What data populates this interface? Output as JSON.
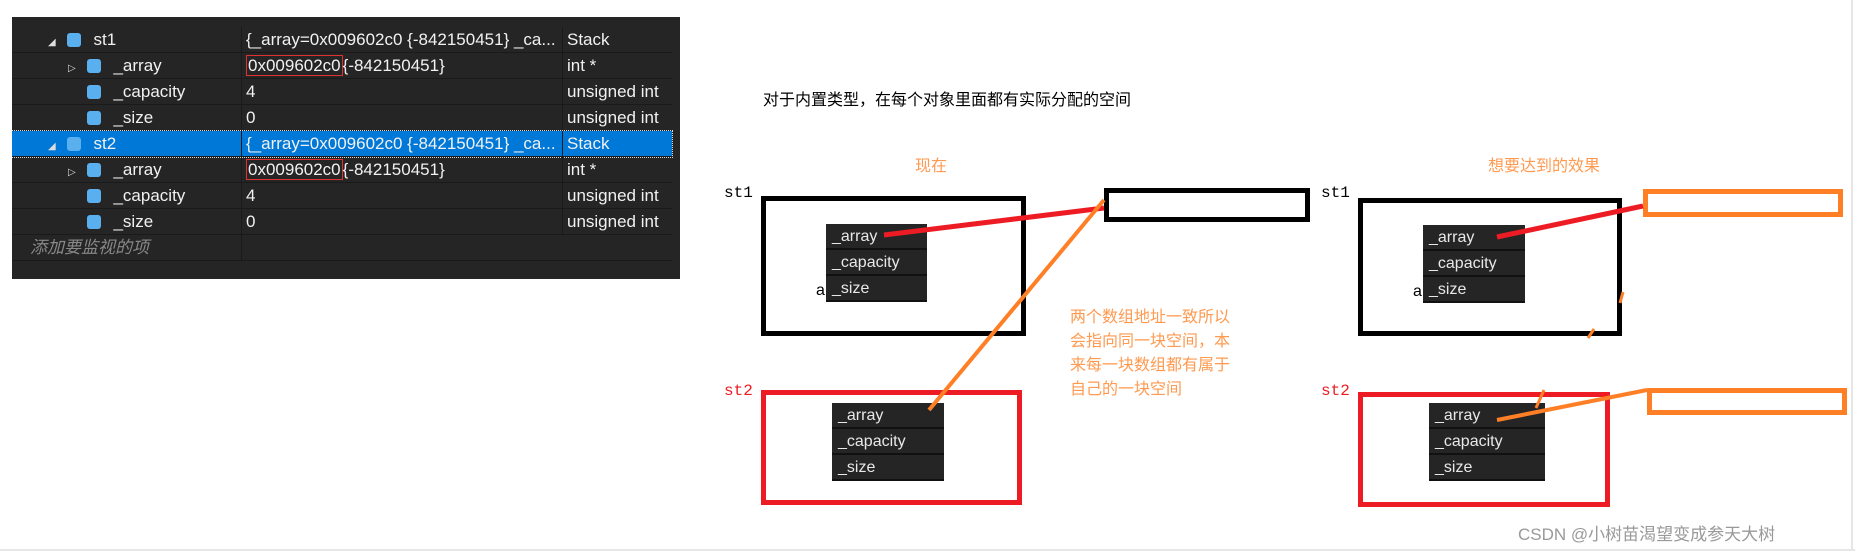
{
  "watch": {
    "rows": [
      {
        "name": "st1",
        "value": "{_array=0x009602c0 {-842150451} _ca...",
        "type": "Stack",
        "expand": "◢"
      },
      {
        "name": "_array",
        "addr": "0x009602c0",
        "value": "{-842150451}",
        "type": "int *",
        "expand": "▷"
      },
      {
        "name": "_capacity",
        "value": "4",
        "type": "unsigned int"
      },
      {
        "name": "_size",
        "value": "0",
        "type": "unsigned int"
      },
      {
        "name": "st2",
        "value": "{_array=0x009602c0 {-842150451} _ca...",
        "type": "Stack",
        "expand": "◢",
        "selected": true
      },
      {
        "name": "_array",
        "addr": "0x009602c0",
        "value": "{-842150451}",
        "type": "int *",
        "expand": "▷"
      },
      {
        "name": "_capacity",
        "value": "4",
        "type": "unsigned int"
      },
      {
        "name": "_size",
        "value": "0",
        "type": "unsigned int"
      }
    ],
    "add_hint": "添加要监视的项"
  },
  "diagram": {
    "heading": "对于内置类型，在每个对象里面都有实际分配的空间",
    "now_label": "现在",
    "goal_label": "想要达到的效果",
    "st1": "st1",
    "st2": "st2",
    "a": "a",
    "fields": [
      "_array",
      "_capacity",
      "_size"
    ],
    "note": [
      "两个数组地址一致所以",
      "会指向同一块空间，本",
      "来每一块数组都有属于",
      "自己的一块空间"
    ],
    "colors": {
      "red": "#ed1c24",
      "orange": "#ff7f27",
      "black": "#000000"
    }
  },
  "watermark": "CSDN @小树苗渴望变成参天大树"
}
